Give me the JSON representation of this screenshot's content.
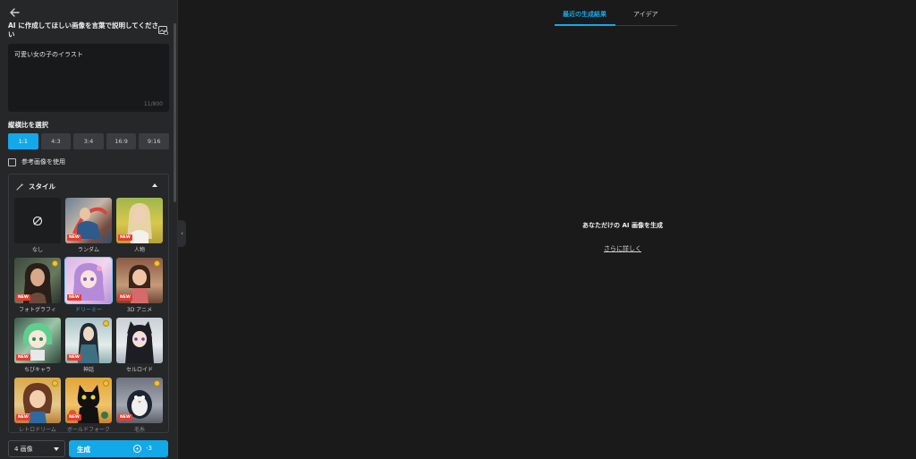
{
  "panel": {
    "prompt_label": "AI に作成してほしい画像を言葉で説明してください",
    "prompt_value": "可愛い女の子のイラスト",
    "char_count": "11/800",
    "ratio_label": "縦横比を選択",
    "ratios": [
      "1:1",
      "4:3",
      "3:4",
      "16:9",
      "9:16"
    ],
    "selected_ratio": "1:1",
    "reference_label": "参考画像を使用",
    "style_title": "スタイル",
    "styles": [
      {
        "label": "なし",
        "icon": "none-icon"
      },
      {
        "label": "ランダム",
        "badge": "NEW"
      },
      {
        "label": "人物",
        "badge": "NEW"
      },
      {
        "label": "フォトグラフィ",
        "badge": "NEW"
      },
      {
        "label": "ドリーミー",
        "badge": "NEW",
        "selected": true
      },
      {
        "label": "3D アニメ",
        "badge": "NEW"
      },
      {
        "label": "ちびキャラ",
        "badge": "NEW"
      },
      {
        "label": "神話",
        "badge": "NEW"
      },
      {
        "label": "セルロイド"
      },
      {
        "label": "レトロドリーム",
        "badge": "NEW"
      },
      {
        "label": "ボールドフォーク",
        "badge": "NEW"
      },
      {
        "label": "毛糸",
        "badge": "NEW"
      }
    ],
    "count_select": "4 画像",
    "generate_label": "生成",
    "credit_cost": "-3"
  },
  "results": {
    "tabs": [
      "最近の生成結果",
      "アイデア"
    ],
    "active_tab": "最近の生成結果",
    "empty_title": "あなただけの AI 画像を生成",
    "learn_more": "さらに詳しく"
  },
  "colors": {
    "accent": "#13a8e8",
    "panel": "#262729",
    "background": "#1a1a1b",
    "badge": "#e63c2f"
  }
}
